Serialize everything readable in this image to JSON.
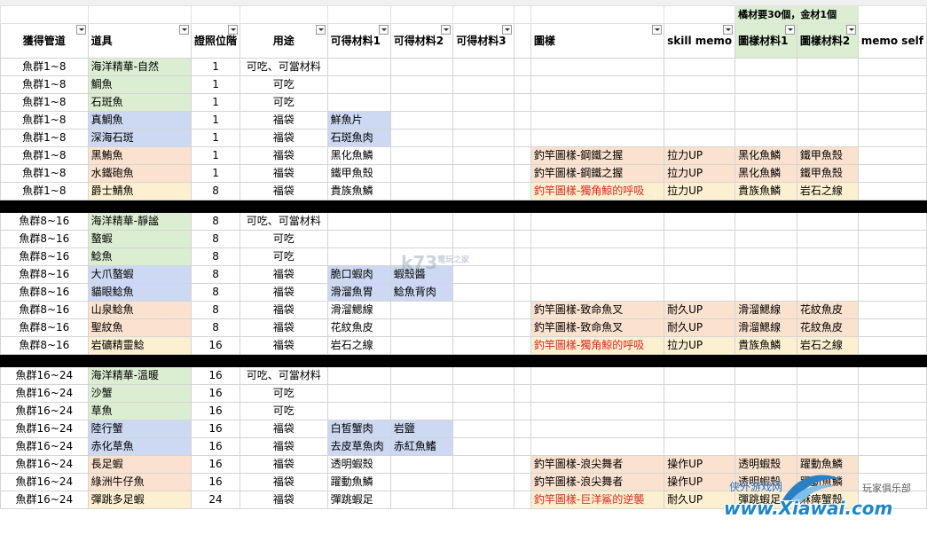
{
  "note": "橘材要30個，金材1個",
  "headers": [
    "獲得管道",
    "道具",
    "證照位階",
    "用途",
    "可得材料1",
    "可得材料2",
    "可得材料3",
    "",
    "圖樣",
    "skill memo",
    "圖樣材料1",
    "圖樣材料2",
    "memo self"
  ],
  "groups": [
    {
      "rows": [
        {
          "src": "魚群1~8",
          "item": "海洋精華-自然",
          "c": "green",
          "lv": "1",
          "use": "可吃、可當材料",
          "m1": "",
          "m2": "",
          "pt": "",
          "sk": "",
          "p1": "",
          "p2": ""
        },
        {
          "src": "魚群1~8",
          "item": "鯛魚",
          "c": "green",
          "lv": "1",
          "use": "可吃",
          "m1": "",
          "m2": "",
          "pt": "",
          "sk": "",
          "p1": "",
          "p2": ""
        },
        {
          "src": "魚群1~8",
          "item": "石斑魚",
          "c": "green",
          "lv": "1",
          "use": "可吃",
          "m1": "",
          "m2": "",
          "pt": "",
          "sk": "",
          "p1": "",
          "p2": ""
        },
        {
          "src": "魚群1~8",
          "item": "真鯛魚",
          "c": "blue",
          "lv": "1",
          "use": "福袋",
          "m1": "鮮魚片",
          "m2": "",
          "pt": "",
          "sk": "",
          "p1": "",
          "p2": ""
        },
        {
          "src": "魚群1~8",
          "item": "深海石斑",
          "c": "blue",
          "lv": "1",
          "use": "福袋",
          "m1": "石斑魚肉",
          "m2": "",
          "pt": "",
          "sk": "",
          "p1": "",
          "p2": ""
        },
        {
          "src": "魚群1~8",
          "item": "黑鮪魚",
          "c": "peach",
          "lv": "1",
          "use": "福袋",
          "m1": "黑化魚鱗",
          "m2": "",
          "pt": "釣竿圖樣-鋼鐵之握",
          "sk": "拉力UP",
          "p1": "黑化魚鱗",
          "p2": "鐵甲魚殼"
        },
        {
          "src": "魚群1~8",
          "item": "水鐵砲魚",
          "c": "peach",
          "lv": "1",
          "use": "福袋",
          "m1": "鐵甲魚殼",
          "m2": "",
          "pt": "釣竿圖樣-鋼鐵之握",
          "sk": "拉力UP",
          "p1": "黑化魚鱗",
          "p2": "鐵甲魚殼"
        },
        {
          "src": "魚群1~8",
          "item": "爵士鯖魚",
          "c": "cream",
          "lv": "8",
          "use": "福袋",
          "m1": "貴族魚鱗",
          "m2": "",
          "pt": "釣竿圖樣-獨角鯨的呼吸",
          "sk": "拉力UP",
          "p1": "貴族魚鱗",
          "p2": "岩石之線",
          "red": true
        }
      ]
    },
    {
      "rows": [
        {
          "src": "魚群8~16",
          "item": "海洋精華-靜謐",
          "c": "green",
          "lv": "8",
          "use": "可吃、可當材料",
          "m1": "",
          "m2": "",
          "pt": "",
          "sk": "",
          "p1": "",
          "p2": ""
        },
        {
          "src": "魚群8~16",
          "item": "螯蝦",
          "c": "green",
          "lv": "8",
          "use": "可吃",
          "m1": "",
          "m2": "",
          "pt": "",
          "sk": "",
          "p1": "",
          "p2": ""
        },
        {
          "src": "魚群8~16",
          "item": "鯰魚",
          "c": "green",
          "lv": "8",
          "use": "可吃",
          "m1": "",
          "m2": "",
          "pt": "",
          "sk": "",
          "p1": "",
          "p2": ""
        },
        {
          "src": "魚群8~16",
          "item": "大爪螯蝦",
          "c": "blue",
          "lv": "8",
          "use": "福袋",
          "m1": "脆口蝦肉",
          "m2": "蝦殼醬",
          "pt": "",
          "sk": "",
          "p1": "",
          "p2": ""
        },
        {
          "src": "魚群8~16",
          "item": "貓眼鯰魚",
          "c": "blue",
          "lv": "8",
          "use": "福袋",
          "m1": "滑溜魚胃",
          "m2": "鯰魚背肉",
          "pt": "",
          "sk": "",
          "p1": "",
          "p2": ""
        },
        {
          "src": "魚群8~16",
          "item": "山泉鯰魚",
          "c": "peach",
          "lv": "8",
          "use": "福袋",
          "m1": "滑溜鰓線",
          "m2": "",
          "pt": "釣竿圖樣-致命魚叉",
          "sk": "耐久UP",
          "p1": "滑溜鰓線",
          "p2": "花紋魚皮"
        },
        {
          "src": "魚群8~16",
          "item": "聖紋魚",
          "c": "peach",
          "lv": "8",
          "use": "福袋",
          "m1": "花紋魚皮",
          "m2": "",
          "pt": "釣竿圖樣-致命魚叉",
          "sk": "耐久UP",
          "p1": "滑溜鰓線",
          "p2": "花紋魚皮"
        },
        {
          "src": "魚群8~16",
          "item": "岩礦精靈鯰",
          "c": "cream",
          "lv": "16",
          "use": "福袋",
          "m1": "岩石之線",
          "m2": "",
          "pt": "釣竿圖樣-獨角鯨的呼吸",
          "sk": "拉力UP",
          "p1": "貴族魚鱗",
          "p2": "岩石之線",
          "red": true
        }
      ]
    },
    {
      "rows": [
        {
          "src": "魚群16~24",
          "item": "海洋精華-溫暖",
          "c": "green",
          "lv": "16",
          "use": "可吃、可當材料",
          "m1": "",
          "m2": "",
          "pt": "",
          "sk": "",
          "p1": "",
          "p2": ""
        },
        {
          "src": "魚群16~24",
          "item": "沙蟹",
          "c": "green",
          "lv": "16",
          "use": "可吃",
          "m1": "",
          "m2": "",
          "pt": "",
          "sk": "",
          "p1": "",
          "p2": ""
        },
        {
          "src": "魚群16~24",
          "item": "草魚",
          "c": "green",
          "lv": "16",
          "use": "可吃",
          "m1": "",
          "m2": "",
          "pt": "",
          "sk": "",
          "p1": "",
          "p2": ""
        },
        {
          "src": "魚群16~24",
          "item": "陸行蟹",
          "c": "blue",
          "lv": "16",
          "use": "福袋",
          "m1": "白皙蟹肉",
          "m2": "岩鹽",
          "pt": "",
          "sk": "",
          "p1": "",
          "p2": ""
        },
        {
          "src": "魚群16~24",
          "item": "赤化草魚",
          "c": "blue",
          "lv": "16",
          "use": "福袋",
          "m1": "去皮草魚肉",
          "m2": "赤紅魚鰭",
          "pt": "",
          "sk": "",
          "p1": "",
          "p2": ""
        },
        {
          "src": "魚群16~24",
          "item": "長足蝦",
          "c": "peach",
          "lv": "16",
          "use": "福袋",
          "m1": "透明蝦殼",
          "m2": "",
          "pt": "釣竿圖樣-浪尖舞者",
          "sk": "操作UP",
          "p1": "透明蝦殼",
          "p2": "躍動魚鱗"
        },
        {
          "src": "魚群16~24",
          "item": "綠洲牛仔魚",
          "c": "peach",
          "lv": "16",
          "use": "福袋",
          "m1": "躍動魚鱗",
          "m2": "",
          "pt": "釣竿圖樣-浪尖舞者",
          "sk": "操作UP",
          "p1": "透明蝦殼",
          "p2": "躍動魚鱗"
        },
        {
          "src": "魚群16~24",
          "item": "彈跳多足蝦",
          "c": "cream",
          "lv": "24",
          "use": "福袋",
          "m1": "彈跳蝦足",
          "m2": "",
          "pt": "釣竿圖樣-巨洋鯊的逆襲",
          "sk": "耐久UP",
          "p1": "彈跳蝦足",
          "p2": "麻痺蟹殼",
          "red": true
        }
      ]
    }
  ],
  "watermarks": {
    "k73": "k73",
    "k73sub": "電玩之家",
    "xiawai": "www.Xiawai.com",
    "xiawai_cn": "侠外游戏网",
    "club": "玩家俱乐部"
  }
}
